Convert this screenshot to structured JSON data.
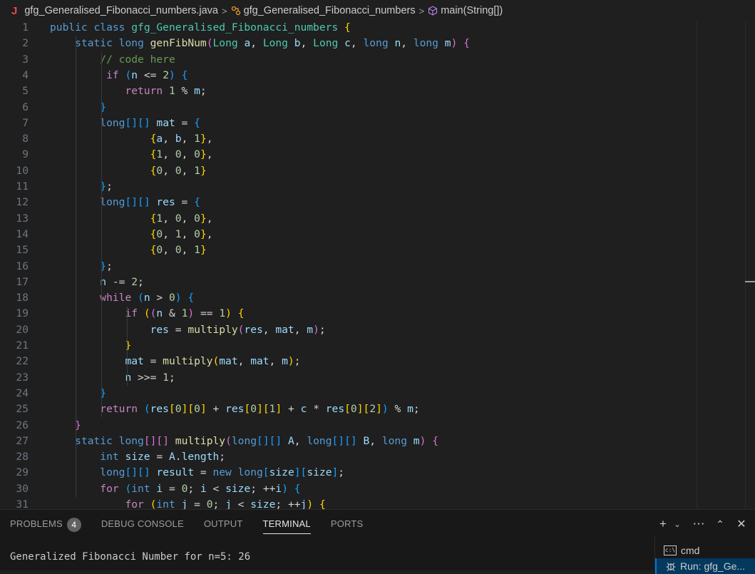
{
  "breadcrumb": {
    "file": "gfg_Generalised_Fibonacci_numbers.java",
    "class": "gfg_Generalised_Fibonacci_numbers",
    "method": "main(String[])"
  },
  "code_lines": [
    {
      "n": "1",
      "t": [
        [
          "kw",
          "public"
        ],
        [
          "pl",
          " "
        ],
        [
          "kw",
          "class"
        ],
        [
          "pl",
          " "
        ],
        [
          "ty",
          "gfg_Generalised_Fibonacci_numbers"
        ],
        [
          "pl",
          " "
        ],
        [
          "b1",
          "{"
        ]
      ]
    },
    {
      "n": "2",
      "t": [
        [
          "pl",
          "    "
        ],
        [
          "kw",
          "static"
        ],
        [
          "pl",
          " "
        ],
        [
          "kw",
          "long"
        ],
        [
          "pl",
          " "
        ],
        [
          "fn",
          "genFibNum"
        ],
        [
          "b2",
          "("
        ],
        [
          "ty",
          "Long"
        ],
        [
          "pl",
          " "
        ],
        [
          "var",
          "a"
        ],
        [
          "pl",
          ", "
        ],
        [
          "ty",
          "Long"
        ],
        [
          "pl",
          " "
        ],
        [
          "var",
          "b"
        ],
        [
          "pl",
          ", "
        ],
        [
          "ty",
          "Long"
        ],
        [
          "pl",
          " "
        ],
        [
          "var",
          "c"
        ],
        [
          "pl",
          ", "
        ],
        [
          "kw",
          "long"
        ],
        [
          "pl",
          " "
        ],
        [
          "var",
          "n"
        ],
        [
          "pl",
          ", "
        ],
        [
          "kw",
          "long"
        ],
        [
          "pl",
          " "
        ],
        [
          "var",
          "m"
        ],
        [
          "b2",
          ")"
        ],
        [
          "pl",
          " "
        ],
        [
          "b2",
          "{"
        ]
      ]
    },
    {
      "n": "3",
      "t": [
        [
          "pl",
          "        "
        ],
        [
          "cm",
          "// code here"
        ]
      ]
    },
    {
      "n": "4",
      "t": [
        [
          "pl",
          "         "
        ],
        [
          "kw2",
          "if"
        ],
        [
          "pl",
          " "
        ],
        [
          "b3",
          "("
        ],
        [
          "var",
          "n"
        ],
        [
          "pl",
          " <= "
        ],
        [
          "num",
          "2"
        ],
        [
          "b3",
          ")"
        ],
        [
          "pl",
          " "
        ],
        [
          "b3",
          "{"
        ]
      ]
    },
    {
      "n": "5",
      "t": [
        [
          "pl",
          "            "
        ],
        [
          "kw2",
          "return"
        ],
        [
          "pl",
          " "
        ],
        [
          "num",
          "1"
        ],
        [
          "pl",
          " % "
        ],
        [
          "var",
          "m"
        ],
        [
          "pl",
          ";"
        ]
      ]
    },
    {
      "n": "6",
      "t": [
        [
          "pl",
          "        "
        ],
        [
          "b3",
          "}"
        ]
      ]
    },
    {
      "n": "7",
      "t": [
        [
          "pl",
          "        "
        ],
        [
          "kw",
          "long"
        ],
        [
          "b3",
          "[]"
        ],
        [
          "b3",
          "[]"
        ],
        [
          "pl",
          " "
        ],
        [
          "var",
          "mat"
        ],
        [
          "pl",
          " = "
        ],
        [
          "b3",
          "{"
        ]
      ]
    },
    {
      "n": "8",
      "t": [
        [
          "pl",
          "                "
        ],
        [
          "b1",
          "{"
        ],
        [
          "var",
          "a"
        ],
        [
          "pl",
          ", "
        ],
        [
          "var",
          "b"
        ],
        [
          "pl",
          ", "
        ],
        [
          "num",
          "1"
        ],
        [
          "b1",
          "}"
        ],
        [
          "pl",
          ","
        ]
      ]
    },
    {
      "n": "9",
      "t": [
        [
          "pl",
          "                "
        ],
        [
          "b1",
          "{"
        ],
        [
          "num",
          "1"
        ],
        [
          "pl",
          ", "
        ],
        [
          "num",
          "0"
        ],
        [
          "pl",
          ", "
        ],
        [
          "num",
          "0"
        ],
        [
          "b1",
          "}"
        ],
        [
          "pl",
          ","
        ]
      ]
    },
    {
      "n": "10",
      "t": [
        [
          "pl",
          "                "
        ],
        [
          "b1",
          "{"
        ],
        [
          "num",
          "0"
        ],
        [
          "pl",
          ", "
        ],
        [
          "num",
          "0"
        ],
        [
          "pl",
          ", "
        ],
        [
          "num",
          "1"
        ],
        [
          "b1",
          "}"
        ]
      ]
    },
    {
      "n": "11",
      "t": [
        [
          "pl",
          "        "
        ],
        [
          "b3",
          "}"
        ],
        [
          "pl",
          ";"
        ]
      ]
    },
    {
      "n": "12",
      "t": [
        [
          "pl",
          "        "
        ],
        [
          "kw",
          "long"
        ],
        [
          "b3",
          "[]"
        ],
        [
          "b3",
          "[]"
        ],
        [
          "pl",
          " "
        ],
        [
          "var",
          "res"
        ],
        [
          "pl",
          " = "
        ],
        [
          "b3",
          "{"
        ]
      ]
    },
    {
      "n": "13",
      "t": [
        [
          "pl",
          "                "
        ],
        [
          "b1",
          "{"
        ],
        [
          "num",
          "1"
        ],
        [
          "pl",
          ", "
        ],
        [
          "num",
          "0"
        ],
        [
          "pl",
          ", "
        ],
        [
          "num",
          "0"
        ],
        [
          "b1",
          "}"
        ],
        [
          "pl",
          ","
        ]
      ]
    },
    {
      "n": "14",
      "t": [
        [
          "pl",
          "                "
        ],
        [
          "b1",
          "{"
        ],
        [
          "num",
          "0"
        ],
        [
          "pl",
          ", "
        ],
        [
          "num",
          "1"
        ],
        [
          "pl",
          ", "
        ],
        [
          "num",
          "0"
        ],
        [
          "b1",
          "}"
        ],
        [
          "pl",
          ","
        ]
      ]
    },
    {
      "n": "15",
      "t": [
        [
          "pl",
          "                "
        ],
        [
          "b1",
          "{"
        ],
        [
          "num",
          "0"
        ],
        [
          "pl",
          ", "
        ],
        [
          "num",
          "0"
        ],
        [
          "pl",
          ", "
        ],
        [
          "num",
          "1"
        ],
        [
          "b1",
          "}"
        ]
      ]
    },
    {
      "n": "16",
      "t": [
        [
          "pl",
          "        "
        ],
        [
          "b3",
          "}"
        ],
        [
          "pl",
          ";"
        ]
      ]
    },
    {
      "n": "17",
      "t": [
        [
          "pl",
          "        "
        ],
        [
          "var",
          "n"
        ],
        [
          "pl",
          " -= "
        ],
        [
          "num",
          "2"
        ],
        [
          "pl",
          ";"
        ]
      ]
    },
    {
      "n": "18",
      "t": [
        [
          "pl",
          "        "
        ],
        [
          "kw2",
          "while"
        ],
        [
          "pl",
          " "
        ],
        [
          "b3",
          "("
        ],
        [
          "var",
          "n"
        ],
        [
          "pl",
          " > "
        ],
        [
          "num",
          "0"
        ],
        [
          "b3",
          ")"
        ],
        [
          "pl",
          " "
        ],
        [
          "b3",
          "{"
        ]
      ]
    },
    {
      "n": "19",
      "t": [
        [
          "pl",
          "            "
        ],
        [
          "kw2",
          "if"
        ],
        [
          "pl",
          " "
        ],
        [
          "b1",
          "("
        ],
        [
          "b2",
          "("
        ],
        [
          "var",
          "n"
        ],
        [
          "pl",
          " & "
        ],
        [
          "num",
          "1"
        ],
        [
          "b2",
          ")"
        ],
        [
          "pl",
          " == "
        ],
        [
          "num",
          "1"
        ],
        [
          "b1",
          ")"
        ],
        [
          "pl",
          " "
        ],
        [
          "b1",
          "{"
        ]
      ]
    },
    {
      "n": "20",
      "t": [
        [
          "pl",
          "                "
        ],
        [
          "var",
          "res"
        ],
        [
          "pl",
          " = "
        ],
        [
          "fn",
          "multiply"
        ],
        [
          "b2",
          "("
        ],
        [
          "var",
          "res"
        ],
        [
          "pl",
          ", "
        ],
        [
          "var",
          "mat"
        ],
        [
          "pl",
          ", "
        ],
        [
          "var",
          "m"
        ],
        [
          "b2",
          ")"
        ],
        [
          "pl",
          ";"
        ]
      ]
    },
    {
      "n": "21",
      "t": [
        [
          "pl",
          "            "
        ],
        [
          "b1",
          "}"
        ]
      ]
    },
    {
      "n": "22",
      "t": [
        [
          "pl",
          "            "
        ],
        [
          "var",
          "mat"
        ],
        [
          "pl",
          " = "
        ],
        [
          "fn",
          "multiply"
        ],
        [
          "b1",
          "("
        ],
        [
          "var",
          "mat"
        ],
        [
          "pl",
          ", "
        ],
        [
          "var",
          "mat"
        ],
        [
          "pl",
          ", "
        ],
        [
          "var",
          "m"
        ],
        [
          "b1",
          ")"
        ],
        [
          "pl",
          ";"
        ]
      ]
    },
    {
      "n": "23",
      "t": [
        [
          "pl",
          "            "
        ],
        [
          "var",
          "n"
        ],
        [
          "pl",
          " >>= "
        ],
        [
          "num",
          "1"
        ],
        [
          "pl",
          ";"
        ]
      ]
    },
    {
      "n": "24",
      "t": [
        [
          "pl",
          "        "
        ],
        [
          "b3",
          "}"
        ]
      ]
    },
    {
      "n": "25",
      "t": [
        [
          "pl",
          "        "
        ],
        [
          "kw2",
          "return"
        ],
        [
          "pl",
          " "
        ],
        [
          "b3",
          "("
        ],
        [
          "var",
          "res"
        ],
        [
          "b1",
          "["
        ],
        [
          "num",
          "0"
        ],
        [
          "b1",
          "]"
        ],
        [
          "b1",
          "["
        ],
        [
          "num",
          "0"
        ],
        [
          "b1",
          "]"
        ],
        [
          "pl",
          " + "
        ],
        [
          "var",
          "res"
        ],
        [
          "b1",
          "["
        ],
        [
          "num",
          "0"
        ],
        [
          "b1",
          "]"
        ],
        [
          "b1",
          "["
        ],
        [
          "num",
          "1"
        ],
        [
          "b1",
          "]"
        ],
        [
          "pl",
          " + "
        ],
        [
          "var",
          "c"
        ],
        [
          "pl",
          " * "
        ],
        [
          "var",
          "res"
        ],
        [
          "b1",
          "["
        ],
        [
          "num",
          "0"
        ],
        [
          "b1",
          "]"
        ],
        [
          "b1",
          "["
        ],
        [
          "num",
          "2"
        ],
        [
          "b1",
          "]"
        ],
        [
          "b3",
          ")"
        ],
        [
          "pl",
          " % "
        ],
        [
          "var",
          "m"
        ],
        [
          "pl",
          ";"
        ]
      ]
    },
    {
      "n": "26",
      "t": [
        [
          "pl",
          "    "
        ],
        [
          "b2",
          "}"
        ]
      ]
    },
    {
      "n": "27",
      "t": [
        [
          "pl",
          "    "
        ],
        [
          "kw",
          "static"
        ],
        [
          "pl",
          " "
        ],
        [
          "kw",
          "long"
        ],
        [
          "b2",
          "[]"
        ],
        [
          "b2",
          "[]"
        ],
        [
          "pl",
          " "
        ],
        [
          "fn",
          "multiply"
        ],
        [
          "b2",
          "("
        ],
        [
          "kw",
          "long"
        ],
        [
          "b3",
          "[]"
        ],
        [
          "b3",
          "[]"
        ],
        [
          "pl",
          " "
        ],
        [
          "var",
          "A"
        ],
        [
          "pl",
          ", "
        ],
        [
          "kw",
          "long"
        ],
        [
          "b3",
          "[]"
        ],
        [
          "b3",
          "[]"
        ],
        [
          "pl",
          " "
        ],
        [
          "var",
          "B"
        ],
        [
          "pl",
          ", "
        ],
        [
          "kw",
          "long"
        ],
        [
          "pl",
          " "
        ],
        [
          "var",
          "m"
        ],
        [
          "b2",
          ")"
        ],
        [
          "pl",
          " "
        ],
        [
          "b2",
          "{"
        ]
      ]
    },
    {
      "n": "28",
      "t": [
        [
          "pl",
          "        "
        ],
        [
          "kw",
          "int"
        ],
        [
          "pl",
          " "
        ],
        [
          "var",
          "size"
        ],
        [
          "pl",
          " = "
        ],
        [
          "var",
          "A"
        ],
        [
          "pl",
          "."
        ],
        [
          "var",
          "length"
        ],
        [
          "pl",
          ";"
        ]
      ]
    },
    {
      "n": "29",
      "t": [
        [
          "pl",
          "        "
        ],
        [
          "kw",
          "long"
        ],
        [
          "b3",
          "[]"
        ],
        [
          "b3",
          "[]"
        ],
        [
          "pl",
          " "
        ],
        [
          "var",
          "result"
        ],
        [
          "pl",
          " = "
        ],
        [
          "kw",
          "new"
        ],
        [
          "pl",
          " "
        ],
        [
          "kw",
          "long"
        ],
        [
          "b3",
          "["
        ],
        [
          "var",
          "size"
        ],
        [
          "b3",
          "]"
        ],
        [
          "b3",
          "["
        ],
        [
          "var",
          "size"
        ],
        [
          "b3",
          "]"
        ],
        [
          "pl",
          ";"
        ]
      ]
    },
    {
      "n": "30",
      "t": [
        [
          "pl",
          "        "
        ],
        [
          "kw2",
          "for"
        ],
        [
          "pl",
          " "
        ],
        [
          "b3",
          "("
        ],
        [
          "kw",
          "int"
        ],
        [
          "pl",
          " "
        ],
        [
          "var",
          "i"
        ],
        [
          "pl",
          " = "
        ],
        [
          "num",
          "0"
        ],
        [
          "pl",
          "; "
        ],
        [
          "var",
          "i"
        ],
        [
          "pl",
          " < "
        ],
        [
          "var",
          "size"
        ],
        [
          "pl",
          "; ++"
        ],
        [
          "var",
          "i"
        ],
        [
          "b3",
          ")"
        ],
        [
          "pl",
          " "
        ],
        [
          "b3",
          "{"
        ]
      ]
    },
    {
      "n": "31",
      "t": [
        [
          "pl",
          "            "
        ],
        [
          "kw2",
          "for"
        ],
        [
          "pl",
          " "
        ],
        [
          "b1",
          "("
        ],
        [
          "kw",
          "int"
        ],
        [
          "pl",
          " "
        ],
        [
          "var",
          "j"
        ],
        [
          "pl",
          " = "
        ],
        [
          "num",
          "0"
        ],
        [
          "pl",
          "; "
        ],
        [
          "var",
          "j"
        ],
        [
          "pl",
          " < "
        ],
        [
          "var",
          "size"
        ],
        [
          "pl",
          "; ++"
        ],
        [
          "var",
          "j"
        ],
        [
          "b1",
          ")"
        ],
        [
          "pl",
          " "
        ],
        [
          "b1",
          "{"
        ]
      ]
    }
  ],
  "panel": {
    "tabs": [
      {
        "label": "PROBLEMS",
        "badge": "4",
        "active": false
      },
      {
        "label": "DEBUG CONSOLE",
        "active": false
      },
      {
        "label": "OUTPUT",
        "active": false
      },
      {
        "label": "TERMINAL",
        "active": true
      },
      {
        "label": "PORTS",
        "active": false
      }
    ],
    "terminal_output": "Generalized Fibonacci Number for n=5: 26",
    "terminals": [
      {
        "label": "cmd",
        "icon": "cmd-icon"
      },
      {
        "label": "Run: gfg_Ge...",
        "icon": "debug-icon"
      }
    ]
  }
}
